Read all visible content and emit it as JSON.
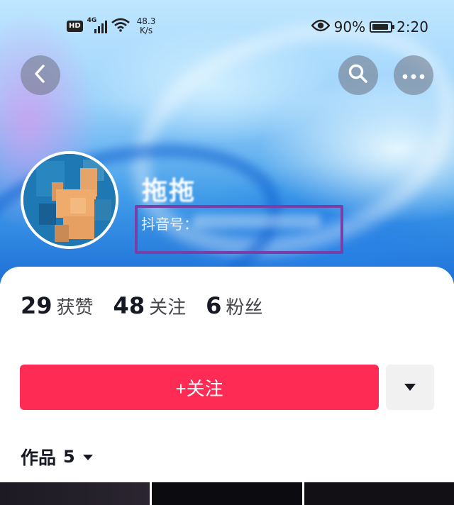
{
  "status_bar": {
    "hd_badge": "HD",
    "network_type": "4G",
    "speed_value": "48.3",
    "speed_unit": "K/s",
    "battery_percent": "90%",
    "battery_level": 0.9,
    "time": "2:20",
    "icons": [
      "signal-icon",
      "wifi-icon",
      "eye-icon",
      "battery-icon"
    ]
  },
  "nav": {
    "icons": [
      "back-arrow-icon",
      "search-icon",
      "more-dots-icon"
    ]
  },
  "profile": {
    "username": "拖拖",
    "id_label": "抖音号："
  },
  "stats": [
    {
      "value": "29",
      "label": "获赞"
    },
    {
      "value": "48",
      "label": "关注"
    },
    {
      "value": "6",
      "label": "粉丝"
    }
  ],
  "actions": {
    "follow_label": "+关注",
    "dropdown_icon": "triangle-down-icon"
  },
  "tabs": {
    "works_label": "作品",
    "works_count": "5"
  },
  "colors": {
    "accent": "#fe2c55",
    "highlight_box": "#7a3fa6",
    "text_primary": "#161823"
  }
}
